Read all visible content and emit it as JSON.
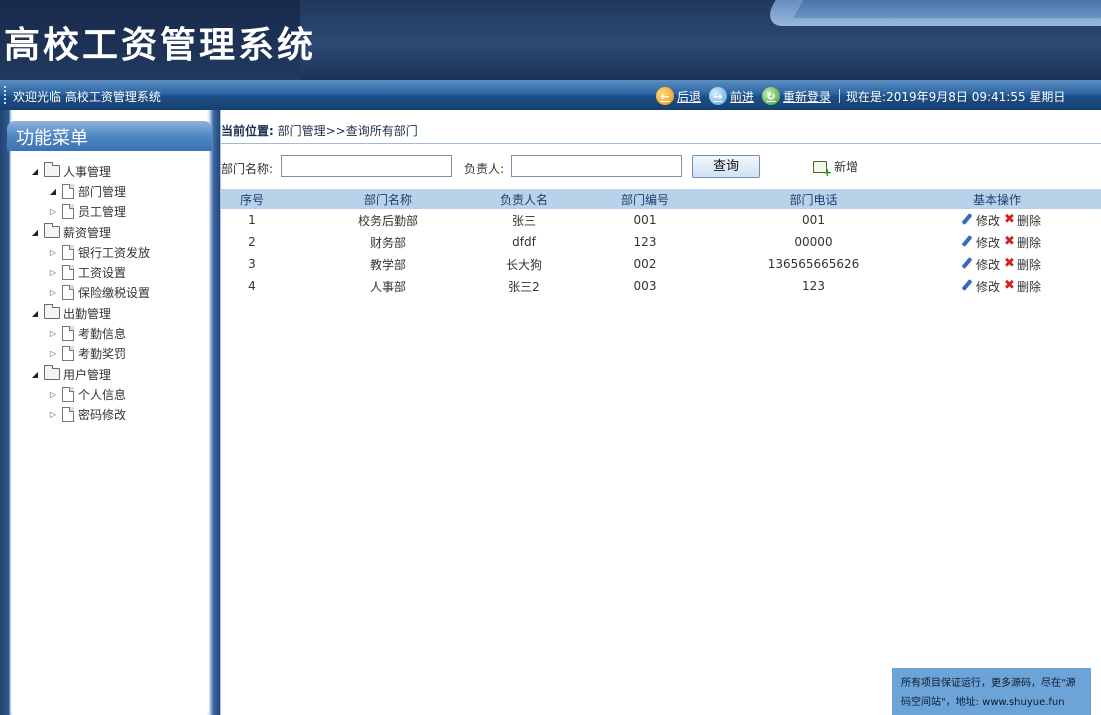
{
  "header": {
    "app_title": "高校工资管理系统"
  },
  "topbar": {
    "welcome": "欢迎光临 高校工资管理系统",
    "back_label": "后退",
    "forward_label": "前进",
    "relogin_label": "重新登录",
    "now_text": "现在是:2019年9月8日 09:41:55 星期日"
  },
  "sidebar": {
    "menu_title": "功能菜单",
    "groups": [
      {
        "label": "人事管理",
        "items": [
          {
            "label": "部门管理"
          },
          {
            "label": "员工管理"
          }
        ]
      },
      {
        "label": "薪资管理",
        "items": [
          {
            "label": "银行工资发放"
          },
          {
            "label": "工资设置"
          },
          {
            "label": "保险缴税设置"
          }
        ]
      },
      {
        "label": "出勤管理",
        "items": [
          {
            "label": "考勤信息"
          },
          {
            "label": "考勤奖罚"
          }
        ]
      },
      {
        "label": "用户管理",
        "items": [
          {
            "label": "个人信息"
          },
          {
            "label": "密码修改"
          }
        ]
      }
    ]
  },
  "breadcrumb": {
    "prefix": "当前位置:",
    "path": " 部门管理>>查询所有部门"
  },
  "search": {
    "dept_name_label": "部门名称:",
    "dept_name_value": "",
    "manager_label": "负责人:",
    "manager_value": "",
    "query_button": "查询",
    "add_button": "新增"
  },
  "table": {
    "columns": [
      "序号",
      "部门名称",
      "负责人名",
      "部门编号",
      "部门电话",
      "基本操作"
    ],
    "edit_label": "修改",
    "delete_label": "删除",
    "rows": [
      [
        "1",
        "校务后勤部",
        "张三",
        "001",
        "001"
      ],
      [
        "2",
        "财务部",
        "dfdf",
        "123",
        "00000"
      ],
      [
        "3",
        "教学部",
        "长大狗",
        "002",
        "136565665626"
      ],
      [
        "4",
        "人事部",
        "张三2",
        "003",
        "123"
      ]
    ]
  },
  "notice": {
    "text": "所有项目保证运行，更多源码，尽在\"源码空间站\"，地址: www.shuyue.fun"
  }
}
